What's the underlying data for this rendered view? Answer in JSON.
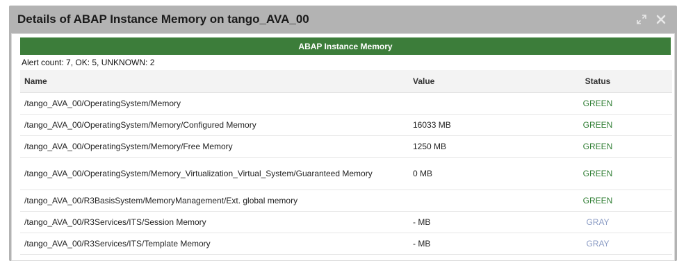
{
  "window": {
    "title": "Details of ABAP Instance Memory on tango_AVA_00",
    "expand_icon": "expand-arrows-icon",
    "close_icon": "close-x-icon"
  },
  "section": {
    "title": "ABAP Instance Memory",
    "alert_summary": "Alert count: 7, OK: 5, UNKNOWN: 2"
  },
  "colors": {
    "header_green": "#3c7d3a",
    "status_green": "#2e7d32",
    "status_gray": "#8a9bc4"
  },
  "table": {
    "columns": {
      "name": "Name",
      "value": "Value",
      "status": "Status"
    },
    "rows": [
      {
        "name": "/tango_AVA_00/OperatingSystem/Memory",
        "value": "",
        "status": "GREEN"
      },
      {
        "name": "/tango_AVA_00/OperatingSystem/Memory/Configured Memory",
        "value": "16033 MB",
        "status": "GREEN"
      },
      {
        "name": "/tango_AVA_00/OperatingSystem/Memory/Free Memory",
        "value": "1250 MB",
        "status": "GREEN"
      },
      {
        "name": "/tango_AVA_00/OperatingSystem/Memory_Virtualization_Virtual_System/Guaranteed Memory",
        "value": "0 MB",
        "status": "GREEN"
      },
      {
        "name": "/tango_AVA_00/R3BasisSystem/MemoryManagement/Ext. global memory",
        "value": "",
        "status": "GREEN"
      },
      {
        "name": "/tango_AVA_00/R3Services/ITS/Session Memory",
        "value": "- MB",
        "status": "GRAY"
      },
      {
        "name": "/tango_AVA_00/R3Services/ITS/Template Memory",
        "value": "- MB",
        "status": "GRAY"
      }
    ]
  }
}
